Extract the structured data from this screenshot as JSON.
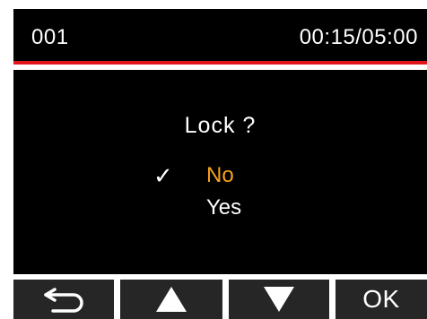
{
  "header": {
    "file_number": "001",
    "time_counter": "00:15/05:00"
  },
  "dialog": {
    "title": "Lock ?",
    "checkmark": "✓",
    "options": [
      {
        "label": "No",
        "selected": true,
        "color": "#f5a21b"
      },
      {
        "label": "Yes",
        "selected": false,
        "color": "#ffffff"
      }
    ]
  },
  "softkeys": {
    "back_icon": "return-arrow-icon",
    "up_icon": "up-triangle-icon",
    "down_icon": "down-triangle-icon",
    "ok_label": "OK"
  },
  "colors": {
    "accent_line": "#e0161b",
    "background": "#000000",
    "softkey_bg": "#262626",
    "selected_text": "#f5a21b"
  }
}
